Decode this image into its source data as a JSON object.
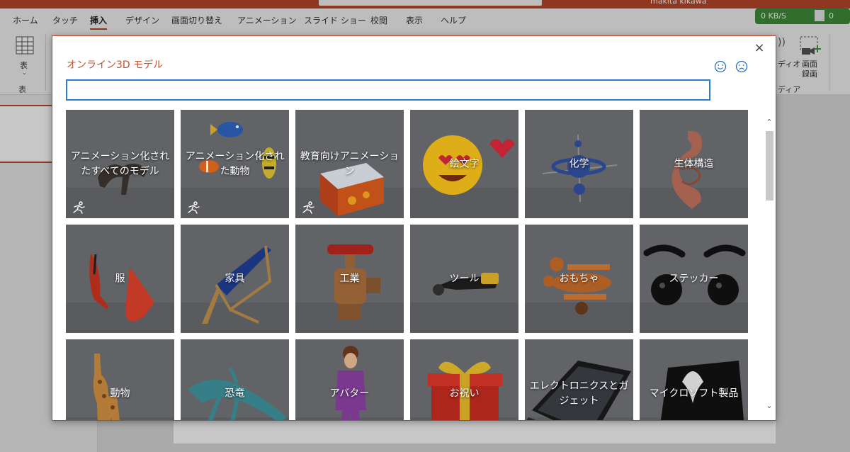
{
  "ribbon": {
    "tabs": [
      {
        "label": "ホーム",
        "active": false
      },
      {
        "label": "タッチ",
        "active": false
      },
      {
        "label": "挿入",
        "active": true
      },
      {
        "label": "デザイン",
        "active": false
      },
      {
        "label": "画面切り替え",
        "active": false
      },
      {
        "label": "アニメーション",
        "active": false
      },
      {
        "label": "スライド ショー",
        "active": false
      },
      {
        "label": "校閲",
        "active": false
      },
      {
        "label": "表示",
        "active": false
      },
      {
        "label": "ヘルプ",
        "active": false
      }
    ],
    "table_button_label": "表",
    "table_group_label": "表",
    "media_partial_label": "ディオ",
    "screen_record_label_1": "画面",
    "screen_record_label_2": "録画",
    "media_group_label": "ディア",
    "net_speed": "0 KB/S",
    "net_count": "0",
    "user_partial": "makita kikawa"
  },
  "dialog": {
    "title": "オンライン3D モデル",
    "close_glyph": "×",
    "search_value": "",
    "search_placeholder": "",
    "tiles": [
      {
        "label": "アニメーション化されたすべてのモデル",
        "animated": true
      },
      {
        "label": "アニメーション化された動物",
        "animated": true
      },
      {
        "label": "教育向けアニメーション",
        "animated": true
      },
      {
        "label": "絵文字",
        "animated": false
      },
      {
        "label": "化学",
        "animated": false
      },
      {
        "label": "生体構造",
        "animated": false
      },
      {
        "label": "服",
        "animated": false
      },
      {
        "label": "家具",
        "animated": false
      },
      {
        "label": "工業",
        "animated": false
      },
      {
        "label": "ツール",
        "animated": false
      },
      {
        "label": "おもちゃ",
        "animated": false
      },
      {
        "label": "ステッカー",
        "animated": false
      },
      {
        "label": "動物",
        "animated": false
      },
      {
        "label": "恐竜",
        "animated": false
      },
      {
        "label": "アバター",
        "animated": false
      },
      {
        "label": "お祝い",
        "animated": false
      },
      {
        "label": "エレクトロニクスとガジェット",
        "animated": false
      },
      {
        "label": "マイクロソフト製品",
        "animated": false
      }
    ]
  },
  "colors": {
    "accent": "#b8472a",
    "title": "#c0552f",
    "search_border": "#2b7cd3",
    "tile_bg": "#6d6f73"
  }
}
